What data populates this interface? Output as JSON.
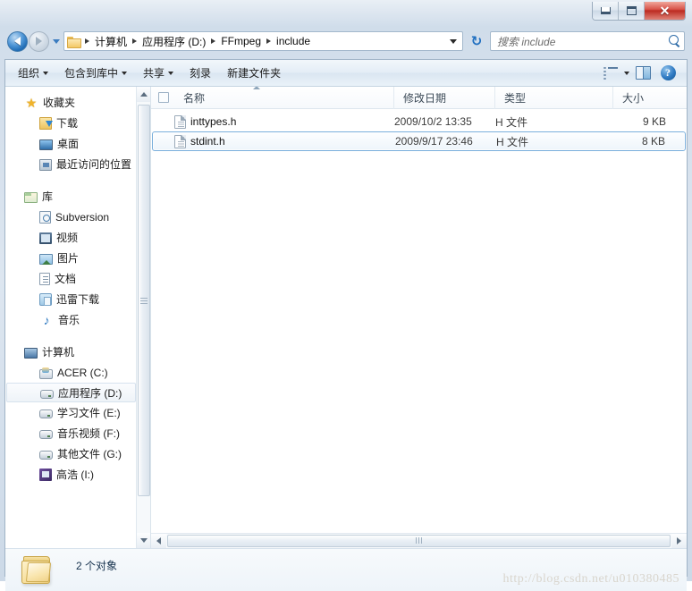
{
  "window": {
    "controls": {
      "minimize_label": "−",
      "maximize_label": "▫",
      "close_label": "✕"
    }
  },
  "address_bar": {
    "back_tooltip": "后退",
    "forward_tooltip": "前进",
    "breadcrumbs": [
      "计算机",
      "应用程序 (D:)",
      "FFmpeg",
      "include"
    ],
    "dropdown_label": "▾",
    "refresh_label": "↻"
  },
  "search": {
    "placeholder": "搜索 include",
    "icon": "search-icon"
  },
  "toolbar": {
    "items": [
      {
        "label": "组织",
        "has_caret": true
      },
      {
        "label": "包含到库中",
        "has_caret": true
      },
      {
        "label": "共享",
        "has_caret": true
      },
      {
        "label": "刻录",
        "has_caret": false
      },
      {
        "label": "新建文件夹",
        "has_caret": false
      }
    ],
    "view_icon": "views-list-icon",
    "view_caret": "▾",
    "preview_pane_icon": "preview-pane-icon",
    "help_icon": "help-icon",
    "help_label": "?"
  },
  "sidebar": {
    "groups": [
      {
        "label": "收藏夹",
        "icon": "star-icon",
        "icon_class": "ic-star",
        "icon_glyph": "★",
        "items": [
          {
            "label": "下载",
            "icon": "download-icon",
            "icon_class": "ic-dl"
          },
          {
            "label": "桌面",
            "icon": "desktop-icon",
            "icon_class": "ic-desk"
          },
          {
            "label": "最近访问的位置",
            "icon": "recent-places-icon",
            "icon_class": "ic-recent"
          }
        ]
      },
      {
        "label": "库",
        "icon": "library-icon",
        "icon_class": "ic-lib",
        "items": [
          {
            "label": "Subversion",
            "icon": "subversion-icon",
            "icon_class": "ic-svn"
          },
          {
            "label": "视频",
            "icon": "video-icon",
            "icon_class": "ic-video"
          },
          {
            "label": "图片",
            "icon": "pictures-icon",
            "icon_class": "ic-pic"
          },
          {
            "label": "文档",
            "icon": "documents-icon",
            "icon_class": "ic-doc"
          },
          {
            "label": "迅雷下载",
            "icon": "thunder-download-icon",
            "icon_class": "ic-thunder"
          },
          {
            "label": "音乐",
            "icon": "music-icon",
            "icon_class": "ic-music",
            "icon_glyph": "♪"
          }
        ]
      },
      {
        "label": "计算机",
        "icon": "computer-icon",
        "icon_class": "ic-pc",
        "items": [
          {
            "label": "ACER (C:)",
            "icon": "system-drive-icon",
            "icon_class": "ic-drivec",
            "selected": false
          },
          {
            "label": "应用程序 (D:)",
            "icon": "drive-icon",
            "icon_class": "ic-drive",
            "selected": true
          },
          {
            "label": "学习文件 (E:)",
            "icon": "drive-icon",
            "icon_class": "ic-drive",
            "selected": false
          },
          {
            "label": "音乐视频 (F:)",
            "icon": "drive-icon",
            "icon_class": "ic-drive",
            "selected": false
          },
          {
            "label": "其他文件 (G:)",
            "icon": "drive-icon",
            "icon_class": "ic-drive",
            "selected": false
          },
          {
            "label": "高浩 (I:)",
            "icon": "network-drive-icon",
            "icon_class": "ic-net",
            "selected": false
          }
        ]
      }
    ]
  },
  "file_list": {
    "columns": [
      {
        "key": "name",
        "label": "名称",
        "sorted": true
      },
      {
        "key": "date",
        "label": "修改日期"
      },
      {
        "key": "type",
        "label": "类型"
      },
      {
        "key": "size",
        "label": "大小"
      }
    ],
    "rows": [
      {
        "name": "inttypes.h",
        "date": "2009/10/2 13:35",
        "type": "H 文件",
        "size": "9 KB",
        "selected": false
      },
      {
        "name": "stdint.h",
        "date": "2009/9/17 23:46",
        "type": "H 文件",
        "size": "8 KB",
        "selected": true
      }
    ]
  },
  "status_bar": {
    "item_count_text": "2 个对象",
    "folder_icon": "folder-icon"
  },
  "watermark": {
    "text": "http://blog.csdn.net/u010380485"
  },
  "colors": {
    "accent_blue": "#1966b0",
    "close_red": "#bc2b21",
    "selection_border": "#7aafdc",
    "folder_yellow": "#f3c866",
    "frame_glass": "#cfdcea"
  }
}
